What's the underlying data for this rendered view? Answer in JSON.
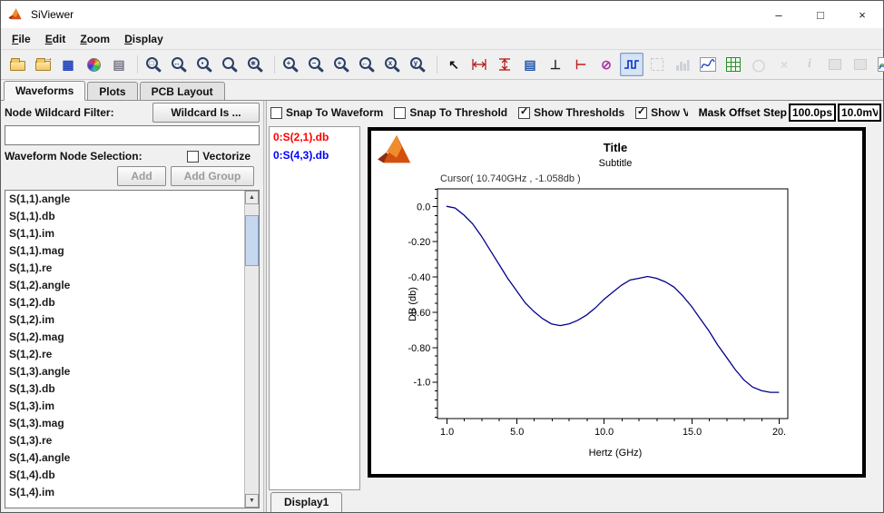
{
  "window": {
    "title": "SiViewer",
    "controls": [
      {
        "name": "minimize-button",
        "glyph": "–"
      },
      {
        "name": "maximize-button",
        "glyph": "□"
      },
      {
        "name": "close-button",
        "glyph": "×"
      }
    ]
  },
  "menu": {
    "items": [
      {
        "label": "File",
        "mnemonic": 0
      },
      {
        "label": "Edit",
        "mnemonic": 0
      },
      {
        "label": "Zoom",
        "mnemonic": 0
      },
      {
        "label": "Display",
        "mnemonic": 0
      }
    ]
  },
  "toolbar": {
    "icons": [
      {
        "name": "open-file",
        "kind": "folder"
      },
      {
        "name": "import-data",
        "kind": "folder2"
      },
      {
        "name": "plot-manager",
        "kind": "glyph",
        "glyph": "▦",
        "color": "#2244bb",
        "size": 14
      },
      {
        "name": "color-map",
        "kind": "wheel"
      },
      {
        "name": "print",
        "kind": "glyph",
        "glyph": "▤",
        "color": "#777788",
        "size": 14
      },
      {
        "kind": "sep"
      },
      {
        "name": "zoom-page",
        "kind": "mag",
        "sub": "□"
      },
      {
        "name": "zoom-fit",
        "kind": "mag",
        "sub": "↔"
      },
      {
        "name": "zoom-window",
        "kind": "mag",
        "sub": "▪"
      },
      {
        "name": "zoom-cursor",
        "kind": "mag",
        "sub": ""
      },
      {
        "name": "zoom-xy",
        "kind": "mag",
        "sub": "∗"
      },
      {
        "kind": "sep"
      },
      {
        "name": "zoom-in",
        "kind": "mag",
        "sub": "+"
      },
      {
        "name": "zoom-out",
        "kind": "mag",
        "sub": "−"
      },
      {
        "name": "zoom-in-x",
        "kind": "mag",
        "sub": "+"
      },
      {
        "name": "zoom-previous",
        "kind": "mag",
        "sub": "←"
      },
      {
        "name": "zoom-x-axis",
        "kind": "mag",
        "sub": "x"
      },
      {
        "name": "zoom-y-axis",
        "kind": "mag",
        "sub": "y"
      },
      {
        "kind": "sep"
      },
      {
        "name": "pan",
        "kind": "glyph",
        "glyph": "↖",
        "color": "#111111",
        "size": 14
      },
      {
        "name": "horizontal-cursors",
        "kind": "hrule"
      },
      {
        "name": "vertical-cursors",
        "kind": "vrule"
      },
      {
        "name": "measurement-report",
        "kind": "glyph",
        "glyph": "▤",
        "color": "#2255aa",
        "size": 14
      },
      {
        "name": "threshold",
        "kind": "glyph",
        "glyph": "⊥",
        "color": "#222222",
        "size": 14
      },
      {
        "name": "add-marker",
        "kind": "glyph",
        "glyph": "⊢",
        "color": "#bb2222",
        "size": 14
      },
      {
        "name": "clear-markers",
        "kind": "glyph",
        "glyph": "⊘",
        "color": "#aa33aa",
        "size": 14
      },
      {
        "name": "show-waveforms",
        "kind": "pulse",
        "active": true
      },
      {
        "name": "overlay-mode",
        "kind": "dashed",
        "enabled": false
      },
      {
        "name": "histogram",
        "kind": "bars",
        "enabled": false
      },
      {
        "name": "waveform-plot",
        "kind": "wave"
      },
      {
        "name": "grid-display",
        "kind": "grid"
      },
      {
        "name": "eye-diagram",
        "kind": "glyph",
        "glyph": "◯",
        "color": "#99aabb",
        "size": 13,
        "enabled": false
      },
      {
        "name": "close-display",
        "kind": "glyph",
        "glyph": "×",
        "color": "#b5b5b5",
        "size": 14,
        "enabled": false
      },
      {
        "name": "info",
        "kind": "glyph",
        "glyph": "i",
        "color": "#7a9ccc",
        "size": 14,
        "serif": true,
        "enabled": false
      },
      {
        "name": "snapshot",
        "kind": "boxgrey",
        "enabled": false
      },
      {
        "name": "copy-display",
        "kind": "boxgrey",
        "enabled": false
      },
      {
        "name": "export-plot",
        "kind": "wave2"
      },
      {
        "name": "mask-test",
        "kind": "glyph",
        "glyph": "◆",
        "color": "#a0a4b8",
        "size": 12,
        "enabled": false
      }
    ]
  },
  "tabs": {
    "active": "Waveforms",
    "items": [
      "Waveforms",
      "Plots",
      "PCB Layout"
    ]
  },
  "left_panel": {
    "filter_label": "Node Wildcard Filter:",
    "wildcard_button_label": "Wildcard Is ...",
    "filter_value": "",
    "selection_label": "Waveform Node Selection:",
    "vectorize_label": "Vectorize",
    "vectorize_checked": false,
    "add_button_label": "Add",
    "add_group_button_label": "Add Group",
    "nodes": [
      "S(1,1).angle",
      "S(1,1).db",
      "S(1,1).im",
      "S(1,1).mag",
      "S(1,1).re",
      "S(1,2).angle",
      "S(1,2).db",
      "S(1,2).im",
      "S(1,2).mag",
      "S(1,2).re",
      "S(1,3).angle",
      "S(1,3).db",
      "S(1,3).im",
      "S(1,3).mag",
      "S(1,3).re",
      "S(1,4).angle",
      "S(1,4).db",
      "S(1,4).im"
    ]
  },
  "options_bar": {
    "checkboxes": [
      {
        "label": "Snap To Waveform",
        "checked": false
      },
      {
        "label": "Snap To Threshold",
        "checked": false
      },
      {
        "label": "Show Thresholds",
        "checked": true
      },
      {
        "label": "Show Viol",
        "checked": true
      }
    ],
    "mask_offset_label": "Mask Offset Step",
    "time_step_value": "100.0ps",
    "voltage_step_value": "10.0mV"
  },
  "waveform_list": {
    "items": [
      {
        "label": "0:S(2,1).db",
        "color": "#ff0000"
      },
      {
        "label": "0:S(4,3).db",
        "color": "#0000ff"
      }
    ]
  },
  "display_tabs": {
    "active": "Display1",
    "items": [
      "Display1"
    ]
  },
  "chart_data": {
    "type": "line",
    "title": "Title",
    "subtitle": "Subtitle",
    "cursor_readout": "Cursor( 10.740GHz , -1.058db )",
    "xlabel": "Hertz (GHz)",
    "ylabel": "DB (db)",
    "xlim": [
      0.5,
      20.5
    ],
    "ylim": [
      -1.21,
      0.1
    ],
    "x_major_ticks": [
      1,
      5,
      10,
      15,
      20
    ],
    "x_tick_labels": [
      "1.0",
      "5.0",
      "10.0",
      "15.0",
      "20."
    ],
    "x_minor_step": 1,
    "y_major_ticks": [
      0.0,
      -0.2,
      -0.4,
      -0.6,
      -0.8,
      -1.0
    ],
    "y_tick_labels": [
      "0.0",
      "-0.20",
      "-0.40",
      "-0.60",
      "-0.80",
      "-1.0"
    ],
    "y_minor_step": 0.05,
    "grid": false,
    "legend": false,
    "series": [
      {
        "name": "0:S(4,3).db",
        "color": "#00008b",
        "x": [
          1.0,
          1.5,
          2.0,
          2.5,
          3.0,
          3.5,
          4.0,
          4.5,
          5.0,
          5.5,
          6.0,
          6.5,
          7.0,
          7.5,
          8.0,
          8.5,
          9.0,
          9.5,
          10.0,
          10.5,
          11.0,
          11.5,
          12.0,
          12.5,
          13.0,
          13.5,
          14.0,
          14.5,
          15.0,
          15.5,
          16.0,
          16.5,
          17.0,
          17.5,
          18.0,
          18.5,
          19.0,
          19.5,
          20.0
        ],
        "y": [
          0.0,
          -0.01,
          -0.05,
          -0.1,
          -0.17,
          -0.25,
          -0.33,
          -0.41,
          -0.48,
          -0.55,
          -0.6,
          -0.64,
          -0.67,
          -0.68,
          -0.67,
          -0.65,
          -0.62,
          -0.58,
          -0.53,
          -0.49,
          -0.45,
          -0.42,
          -0.41,
          -0.4,
          -0.41,
          -0.43,
          -0.46,
          -0.51,
          -0.57,
          -0.64,
          -0.71,
          -0.79,
          -0.86,
          -0.93,
          -0.99,
          -1.03,
          -1.05,
          -1.06,
          -1.06
        ]
      }
    ]
  }
}
